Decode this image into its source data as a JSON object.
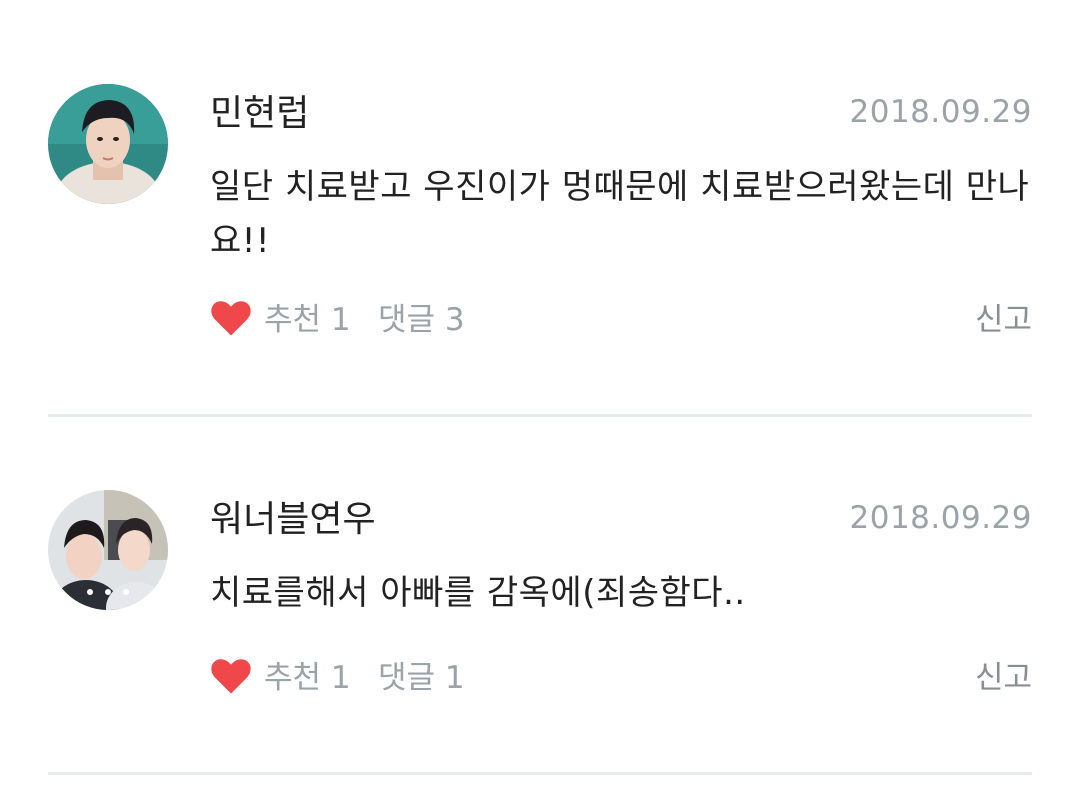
{
  "comments": [
    {
      "username": "민현럽",
      "date": "2018.09.29",
      "text": "일단 치료받고 우진이가 멍때문에 치료받으러왔는데 만나요!!",
      "recommend_label": "추천 1",
      "reply_label": "댓글 3",
      "report_label": "신고"
    },
    {
      "username": "워너블연우",
      "date": "2018.09.29",
      "text": "치료를해서 아빠를 감옥에(죄송함다..",
      "recommend_label": "추천 1",
      "reply_label": "댓글 1",
      "report_label": "신고"
    }
  ],
  "colors": {
    "heart": "#f0474a",
    "meta_text": "#9aa3a8",
    "divider": "#e6ebec"
  },
  "icons": {
    "like": "heart-icon"
  }
}
